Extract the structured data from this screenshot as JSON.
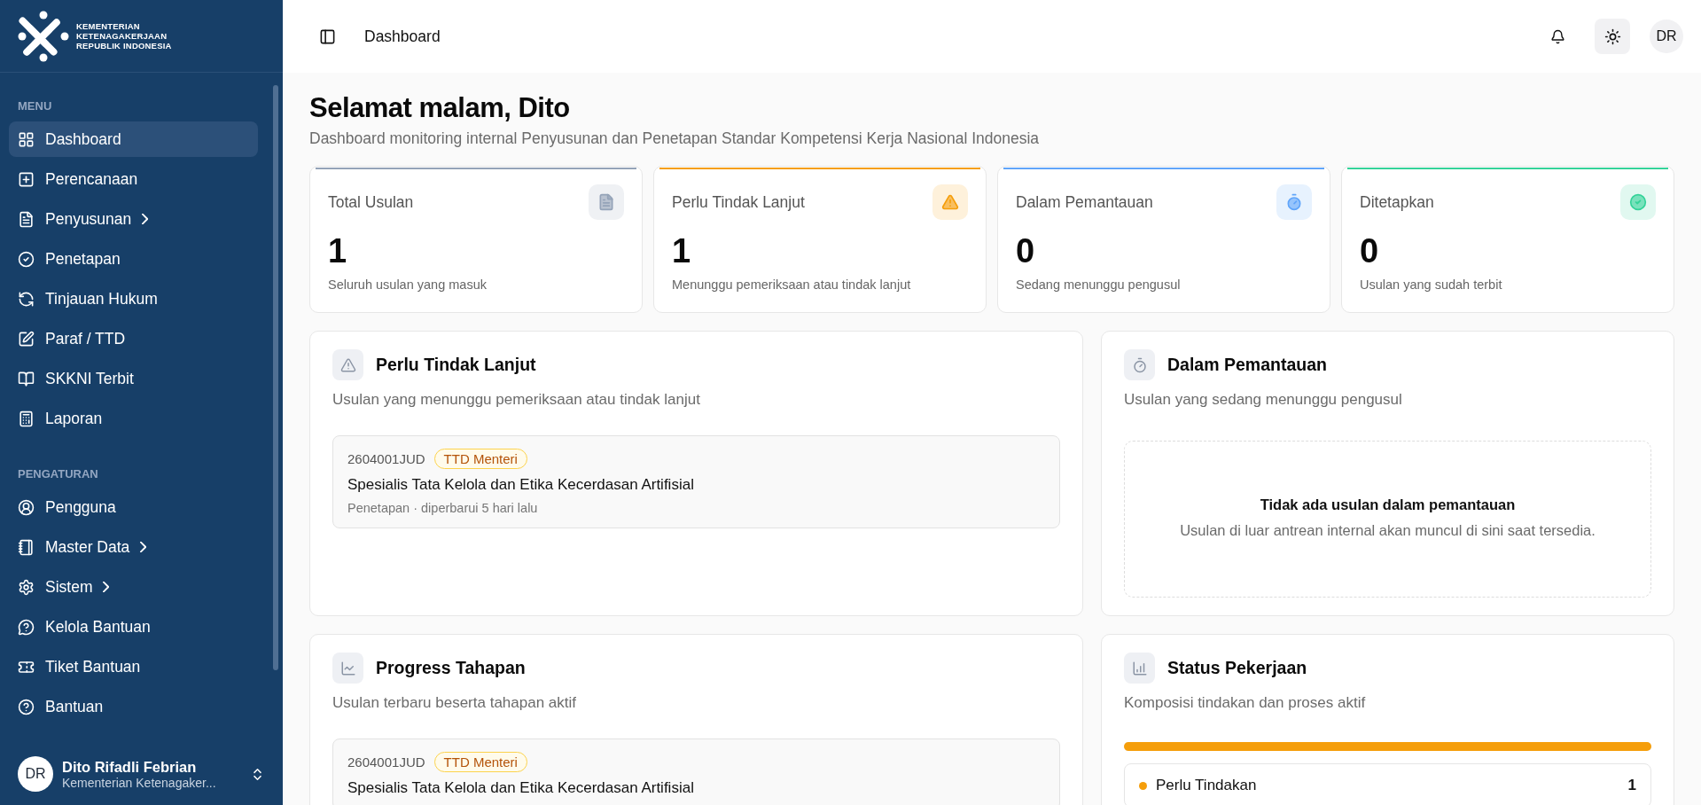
{
  "sidebar": {
    "logo_lines": [
      "KEMENTERIAN",
      "KETENAGAKERJAAN",
      "REPUBLIK INDONESIA"
    ],
    "sections": [
      {
        "heading": "MENU",
        "items": [
          {
            "label": "Dashboard",
            "selected": true,
            "has_submenu": false
          },
          {
            "label": "Perencanaan",
            "selected": false,
            "has_submenu": false
          },
          {
            "label": "Penyusunan",
            "selected": false,
            "has_submenu": true
          },
          {
            "label": "Penetapan",
            "selected": false,
            "has_submenu": false
          },
          {
            "label": "Tinjauan Hukum",
            "selected": false,
            "has_submenu": false
          },
          {
            "label": "Paraf / TTD",
            "selected": false,
            "has_submenu": false
          },
          {
            "label": "SKKNI Terbit",
            "selected": false,
            "has_submenu": false
          },
          {
            "label": "Laporan",
            "selected": false,
            "has_submenu": false
          }
        ]
      },
      {
        "heading": "PENGATURAN",
        "items": [
          {
            "label": "Pengguna",
            "selected": false,
            "has_submenu": false
          },
          {
            "label": "Master Data",
            "selected": false,
            "has_submenu": true
          },
          {
            "label": "Sistem",
            "selected": false,
            "has_submenu": true
          },
          {
            "label": "Kelola Bantuan",
            "selected": false,
            "has_submenu": false
          },
          {
            "label": "Tiket Bantuan",
            "selected": false,
            "has_submenu": false
          },
          {
            "label": "Bantuan",
            "selected": false,
            "has_submenu": false
          }
        ]
      }
    ],
    "user": {
      "initials": "DR",
      "name": "Dito Rifadli Febrian",
      "org": "Kementerian Ketenagaker..."
    }
  },
  "header": {
    "title": "Dashboard",
    "avatar": "DR"
  },
  "greeting": {
    "title": "Selamat malam, Dito",
    "subtitle": "Dashboard monitoring internal Penyusunan dan Penetapan Standar Kompetensi Kerja Nasional Indonesia"
  },
  "stats": [
    {
      "label": "Total Usulan",
      "value": "1",
      "caption": "Seluruh usulan yang masuk",
      "color": "#94a3b8"
    },
    {
      "label": "Perlu Tindak Lanjut",
      "value": "1",
      "caption": "Menunggu pemeriksaan atau tindak lanjut",
      "color": "#f59e0b"
    },
    {
      "label": "Dalam Pemantauan",
      "value": "0",
      "caption": "Sedang menunggu pengusul",
      "color": "#60a5fa"
    },
    {
      "label": "Ditetapkan",
      "value": "0",
      "caption": "Usulan yang sudah terbit",
      "color": "#34d399"
    }
  ],
  "panels": [
    {
      "kind": "list",
      "title": "Perlu Tindak Lanjut",
      "subtitle": "Usulan yang menunggu pemeriksaan atau tindak lanjut",
      "items": [
        {
          "code": "2604001JUD",
          "badge": "TTD Menteri",
          "title": "Spesialis Tata Kelola dan Etika Kecerdasan Artifisial",
          "meta": "Penetapan · diperbarui 5 hari lalu"
        }
      ]
    },
    {
      "kind": "empty",
      "title": "Dalam Pemantauan",
      "subtitle": "Usulan yang sedang menunggu pengusul",
      "empty_title": "Tidak ada usulan dalam pemantauan",
      "empty_text": "Usulan di luar antrean internal akan muncul di sini saat tersedia."
    },
    {
      "kind": "list",
      "title": "Progress Tahapan",
      "subtitle": "Usulan terbaru beserta tahapan aktif",
      "items": [
        {
          "code": "2604001JUD",
          "badge": "TTD Menteri",
          "title": "Spesialis Tata Kelola dan Etika Kecerdasan Artifisial"
        }
      ]
    },
    {
      "kind": "status",
      "title": "Status Pekerjaan",
      "subtitle": "Komposisi tindakan dan proses aktif",
      "bar": {
        "level": 1,
        "color": "#f59e0b"
      },
      "legend": [
        {
          "label": "Perlu Tindakan",
          "count": "1",
          "color": "#f59e0b"
        }
      ]
    }
  ]
}
